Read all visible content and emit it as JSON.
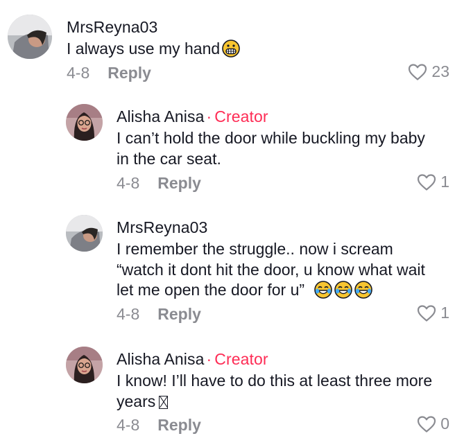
{
  "colors": {
    "creator": "#fe2c55",
    "meta": "#8a8b91",
    "text": "#161823"
  },
  "comments": [
    {
      "username": "MrsReyna03",
      "is_creator": false,
      "lines": [
        "I always use my hand"
      ],
      "emoji": "grimacing-face",
      "date": "4-8",
      "reply_label": "Reply",
      "likes": "23"
    },
    {
      "username": "Alisha Anisa",
      "creator_sep": "·",
      "creator_label": "Creator",
      "is_creator": true,
      "lines": [
        "I can’t hold the door while buckling my baby",
        "in the car seat."
      ],
      "date": "4-8",
      "reply_label": "Reply",
      "likes": "1"
    },
    {
      "username": "MrsReyna03",
      "is_creator": false,
      "lines": [
        "I remember the struggle.. now i scream",
        "“watch it dont hit the door, u know what wait",
        "let me open the door for u”"
      ],
      "emoji": "tears-of-joy x3",
      "date": "4-8",
      "reply_label": "Reply",
      "likes": "1"
    },
    {
      "username": "Alisha Anisa",
      "creator_sep": "·",
      "creator_label": "Creator",
      "is_creator": true,
      "lines": [
        "I know! I’ll have to do this at least three more",
        "years"
      ],
      "emoji": "missing-glyph",
      "date": "4-8",
      "reply_label": "Reply",
      "likes": "0"
    }
  ]
}
